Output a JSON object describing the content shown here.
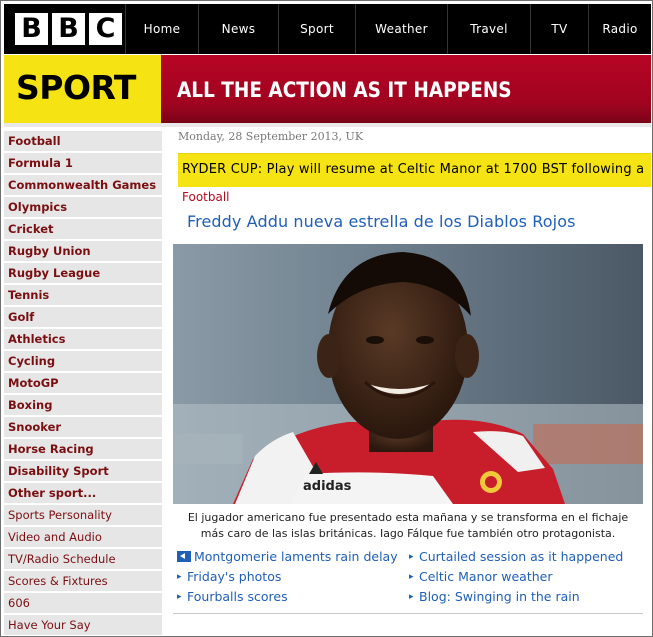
{
  "header": {
    "logo_letters": [
      "B",
      "B",
      "C"
    ],
    "nav": [
      "Home",
      "News",
      "Sport",
      "Weather",
      "Travel",
      "TV",
      "Radio"
    ]
  },
  "banner": {
    "section": "SPORT",
    "tagline": "ALL THE ACTION AS IT HAPPENS"
  },
  "sidebar": {
    "primary": [
      "Football",
      "Formula 1",
      "Commonwealth Games",
      "Olympics",
      "Cricket",
      "Rugby Union",
      "Rugby League",
      "Tennis",
      "Golf",
      "Athletics",
      "Cycling",
      "MotoGP",
      "Boxing",
      "Snooker",
      "Horse Racing",
      "Disability Sport",
      "Other sport..."
    ],
    "secondary": [
      "Sports Personality",
      "Video and Audio",
      "TV/Radio Schedule",
      "Scores & Fixtures",
      "606",
      "Have Your Say"
    ]
  },
  "main": {
    "date": "Monday, 28 September 2013, UK",
    "ticker": "RYDER CUP: Play will resume at Celtic Manor at 1700 BST following a",
    "kicker": "Football",
    "headline": "Freddy Addu nueva estrella  de los Diablos Rojos",
    "caption_line1": "El jugador americano fue presentado esta mañana y se transforma en el fichaje",
    "caption_line2": "más caro de las islas británicas. Iago Fálque fue también otro protagonista.",
    "photo_kit_text": "adidas",
    "links_left": [
      "Montgomerie laments rain delay",
      "Friday's photos",
      "Fourballs scores"
    ],
    "links_right": [
      "Curtailed session as it happened",
      "Celtic Manor weather",
      "Blog: Swinging in the rain"
    ]
  },
  "colors": {
    "sport_yellow": "#f5e314",
    "banner_red": "#b70524",
    "sidebar_text": "#7a0f12",
    "link_blue": "#1f5fb5",
    "kicker_red": "#b30c21"
  },
  "icons": [
    "audio-icon",
    "bullet-arrow-icon"
  ]
}
